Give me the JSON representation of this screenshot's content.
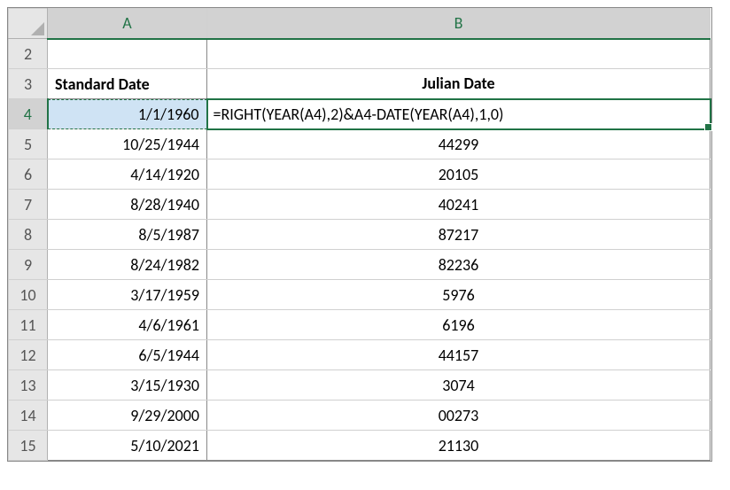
{
  "columns": {
    "a": "A",
    "b": "B"
  },
  "row_numbers": [
    "2",
    "3",
    "4",
    "5",
    "6",
    "7",
    "8",
    "9",
    "10",
    "11",
    "12",
    "13",
    "14",
    "15"
  ],
  "headers": {
    "a": "Standard Date",
    "b": "Julian Date"
  },
  "formula_cell": "=RIGHT(YEAR(A4),2)&A4-DATE(YEAR(A4),1,0)",
  "rows": [
    {
      "a": "1/1/1960",
      "b": ""
    },
    {
      "a": "10/25/1944",
      "b": "44299"
    },
    {
      "a": "4/14/1920",
      "b": "20105"
    },
    {
      "a": "8/28/1940",
      "b": "40241"
    },
    {
      "a": "8/5/1987",
      "b": "87217"
    },
    {
      "a": "8/24/1982",
      "b": "82236"
    },
    {
      "a": "3/17/1959",
      "b": "5976"
    },
    {
      "a": "4/6/1961",
      "b": "6196"
    },
    {
      "a": "6/5/1944",
      "b": "44157"
    },
    {
      "a": "3/15/1930",
      "b": "3074"
    },
    {
      "a": "9/29/2000",
      "b": "00273"
    },
    {
      "a": "5/10/2021",
      "b": "21130"
    }
  ]
}
